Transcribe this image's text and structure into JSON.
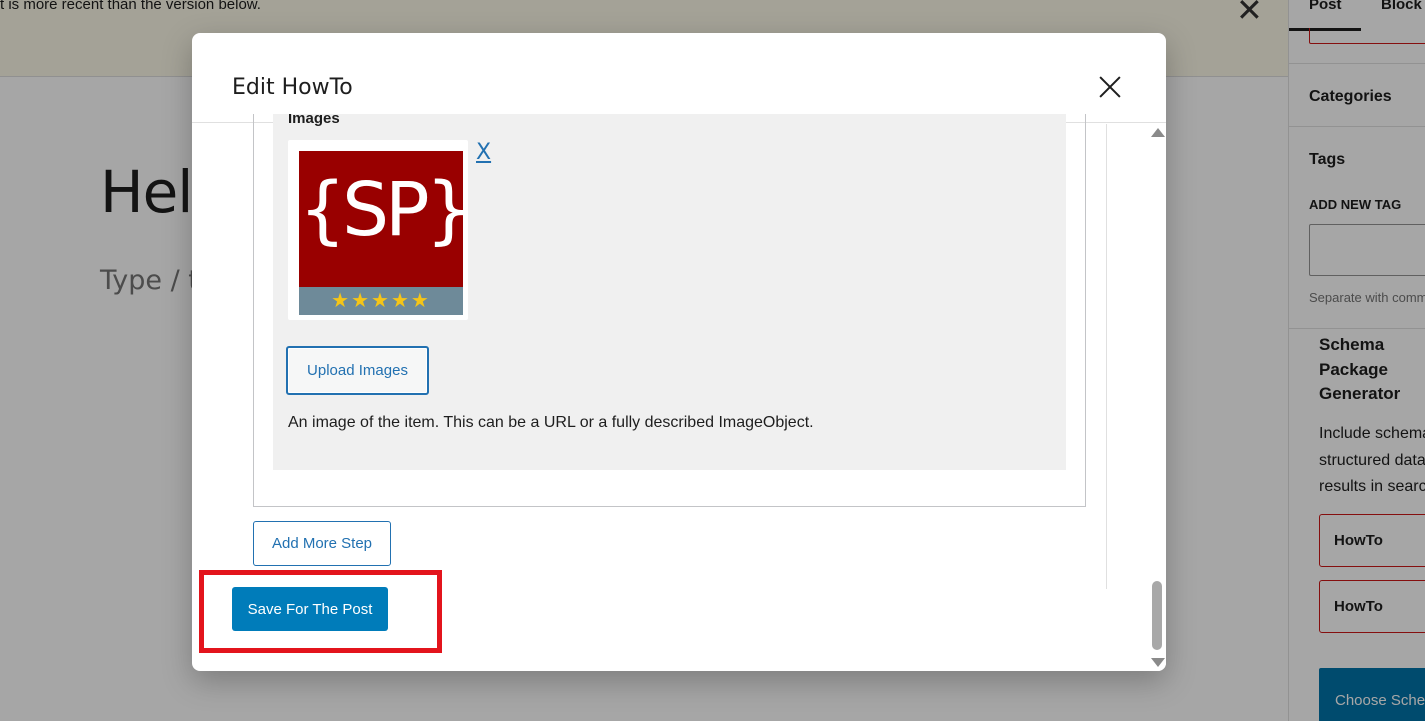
{
  "notice": {
    "text": "t is more recent than the version below.",
    "close_label": "✕"
  },
  "editor": {
    "title_partial": "Hel",
    "placeholder_partial": "Type / t"
  },
  "sidebar": {
    "tab_post": "Post",
    "tab_block": "Block",
    "categories_heading": "Categories",
    "tags_heading": "Tags",
    "add_new_tag_label": "ADD NEW TAG",
    "tag_help": "Separate with commas",
    "schema_title": "Schema Package Generator",
    "schema_desc_lines": [
      "Include schema",
      "structured data",
      "results in search"
    ],
    "howto_item_1": "HowTo",
    "howto_item_2": "HowTo",
    "choose_button": "Choose Schema"
  },
  "modal": {
    "title": "Edit HowTo",
    "images_label": "Images",
    "image_logo_text": "{SP}",
    "image_logo_stars": "★★★★★",
    "remove_image_label": "X",
    "upload_button": "Upload Images",
    "image_description": "An image of the item. This can be a URL or a fully described ImageObject.",
    "add_step_button": "Add More Step",
    "save_button": "Save For The Post"
  },
  "colors": {
    "primary": "#007cba",
    "link": "#2271b1",
    "highlight": "#e3141c",
    "logo_red": "#990000"
  }
}
